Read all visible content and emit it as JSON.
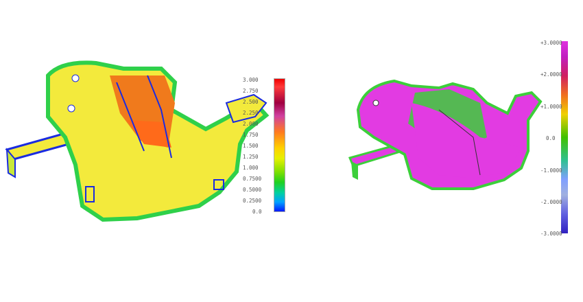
{
  "left_scale": {
    "ticks": [
      "3.000",
      "2.750",
      "2.500",
      "2.250",
      "2.000",
      "1.750",
      "1.500",
      "1.250",
      "1.000",
      "0.7500",
      "0.5000",
      "0.2500",
      "0.0"
    ]
  },
  "right_scale": {
    "ticks": [
      "+3.0000",
      "+2.0000",
      "+1.0000",
      "0.0",
      "-1.0000",
      "-2.0000",
      "-3.0000"
    ]
  },
  "colors": {
    "yellow": "#f3ea3c",
    "green": "#3ccf3a",
    "magenta": "#e23be2",
    "orange": "#f07a1c",
    "blue": "#1a2be0"
  }
}
